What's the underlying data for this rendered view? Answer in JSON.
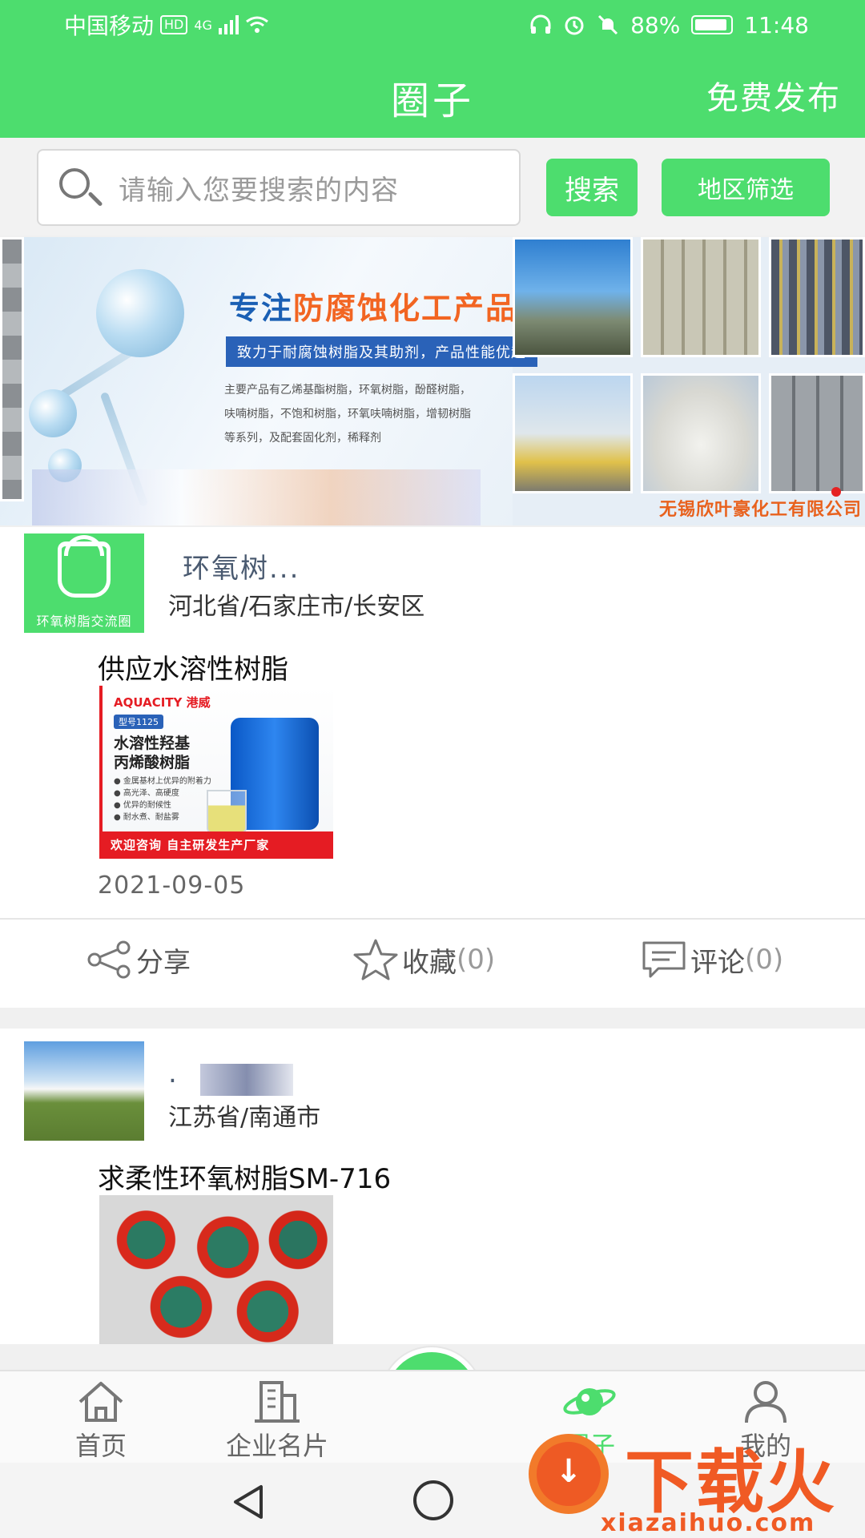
{
  "status_bar": {
    "carrier": "中国移动",
    "hd": "HD",
    "network": "4G",
    "battery": "88%",
    "time": "11:48"
  },
  "header": {
    "title": "圈子",
    "publish": "免费发布"
  },
  "search": {
    "placeholder": "请输入您要搜索的内容",
    "search_button": "搜索",
    "region_button": "地区筛选"
  },
  "banner": {
    "title_prefix": "专注",
    "title_highlight": "防腐蚀化工产品",
    "subtitle": "致力于耐腐蚀树脂及其助剂，产品性能优越",
    "description": "主要产品有乙烯基酯树脂，环氧树脂，酚醛树脂，呋喃树脂，不饱和树脂，环氧呋喃树脂，增韧树脂等系列，及配套固化剂，稀释剂",
    "company": "无锡欣叶豪化工有限公司"
  },
  "posts": [
    {
      "avatar_caption": "环氧树脂交流圈",
      "name": "环氧树...",
      "location": "河北省/石家庄市/长安区",
      "title": "供应水溶性树脂",
      "image": {
        "brand": "AQUACITY 港威",
        "tag": "型号1125",
        "headline_1": "水溶性羟基",
        "headline_2": "丙烯酸树脂",
        "bullets": "● 金属基材上优异的附着力\n● 高光泽、高硬度\n● 优异的耐候性\n● 耐水煮、耐盐雾",
        "footer": "欢迎咨询  自主研发生产厂家"
      },
      "date": "2021-09-05",
      "share": "分享",
      "favorite": "收藏",
      "favorite_count": "(0)",
      "comment": "评论",
      "comment_count": "(0)"
    },
    {
      "name": ".",
      "location": "江苏省/南通市",
      "title": "求柔性环氧树脂SM-716"
    }
  ],
  "tabbar": {
    "home": "首页",
    "card": "企业名片",
    "circle": "圈子",
    "mine": "我的"
  },
  "watermark": {
    "text": "下载火",
    "url": "xiazaihuo.com"
  },
  "colors": {
    "brand_green": "#4ddd6e",
    "watermark_orange": "#f05a24"
  }
}
